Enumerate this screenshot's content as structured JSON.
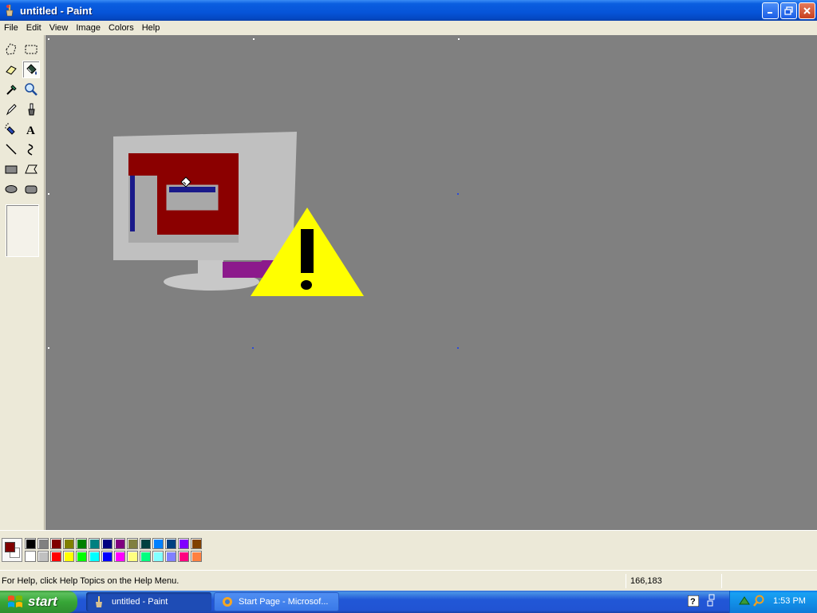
{
  "window": {
    "title": "untitled - Paint"
  },
  "menu": [
    "File",
    "Edit",
    "View",
    "Image",
    "Colors",
    "Help"
  ],
  "colors": {
    "foreground": "#800000",
    "background": "#ffffff",
    "palette_top": [
      "#000000",
      "#808080",
      "#800000",
      "#808000",
      "#008000",
      "#008080",
      "#000080",
      "#800080",
      "#808040",
      "#004040",
      "#0080ff",
      "#004080",
      "#8000ff",
      "#804000"
    ],
    "palette_bottom": [
      "#ffffff",
      "#c0c0c0",
      "#ff0000",
      "#ffff00",
      "#00ff00",
      "#00ffff",
      "#0000ff",
      "#ff00ff",
      "#ffff80",
      "#00ff80",
      "#80ffff",
      "#8080ff",
      "#ff0080",
      "#ff8040"
    ]
  },
  "status": {
    "help_text": "For Help, click Help Topics on the Help Menu.",
    "coords": "166,183"
  },
  "taskbar": {
    "start_label": "start",
    "tasks": [
      "untitled - Paint",
      "Start Page - Microsof..."
    ],
    "clock": "1:53 PM"
  }
}
